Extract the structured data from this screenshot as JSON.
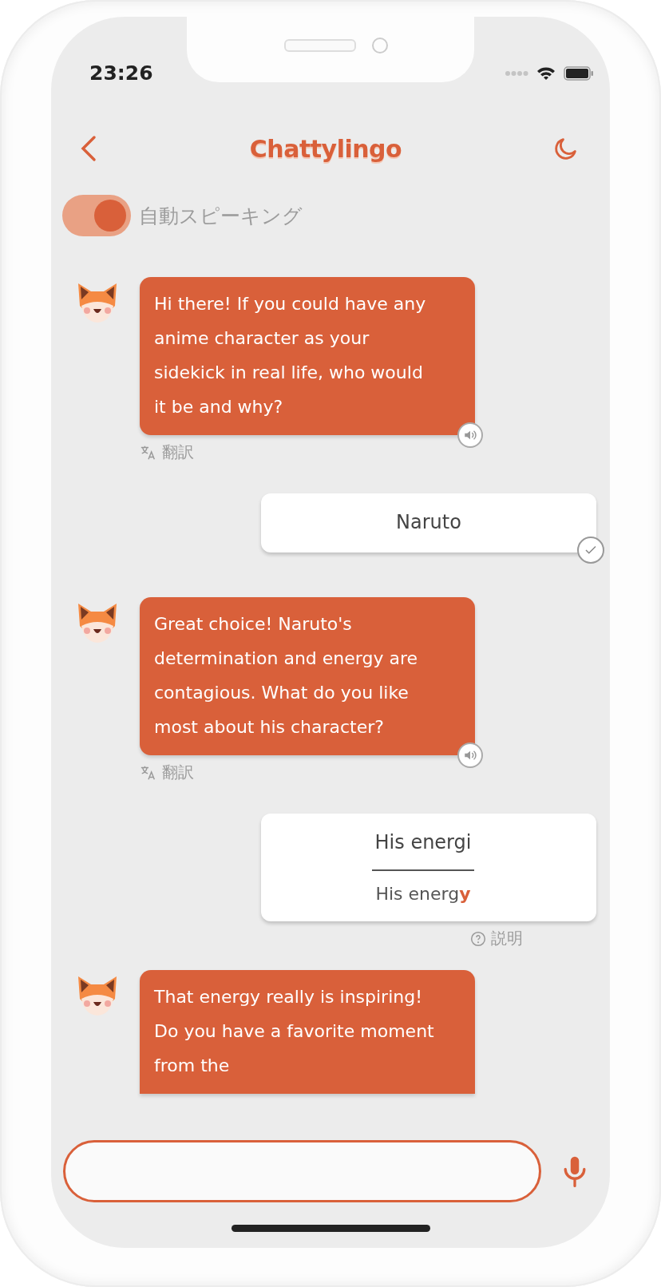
{
  "status_bar": {
    "time": "23:26"
  },
  "header": {
    "title": "Chattylingo"
  },
  "auto_speaking": {
    "label": "自動スピーキング",
    "on": true
  },
  "messages": [
    {
      "kind": "bot",
      "text": "Hi there! If you could have any anime character as your sidekick in real life, who would it be and why?",
      "translate_label": "翻訳"
    },
    {
      "kind": "user",
      "text": "Naruto",
      "checked": true
    },
    {
      "kind": "bot",
      "text": "Great choice! Naruto's determination and energy are contagious. What do you like most about his character?",
      "translate_label": "翻訳"
    },
    {
      "kind": "correction",
      "original": "His energi",
      "corrected": "His energ**y**",
      "explain_label": "説明"
    },
    {
      "kind": "bot",
      "text": "That energy really is inspiring! Do you have a favorite moment from the"
    }
  ]
}
